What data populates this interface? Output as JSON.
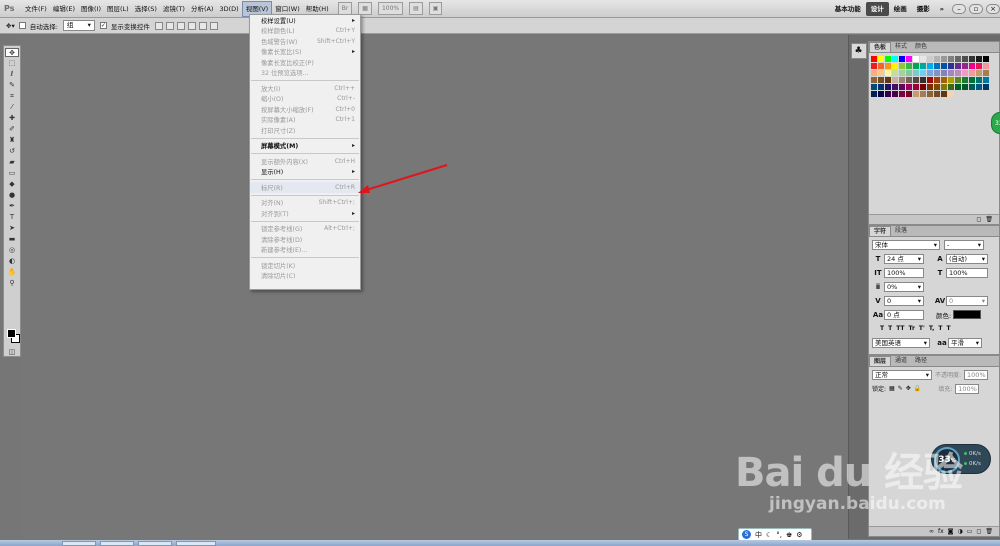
{
  "app": {
    "logo": "Ps"
  },
  "menubar": {
    "items": [
      "文件(F)",
      "编辑(E)",
      "图像(I)",
      "图层(L)",
      "选择(S)",
      "滤镜(T)",
      "分析(A)",
      "3D(D)",
      "视图(V)",
      "窗口(W)",
      "帮助(H)"
    ],
    "zoom": "100%",
    "workspaces": [
      "基本功能",
      "设计",
      "绘画",
      "摄影"
    ],
    "active_workspace": "设计",
    "more": "»"
  },
  "options": {
    "auto_select_label": "自动选择:",
    "auto_select_value": "组",
    "show_transform_label": "显示变换控件"
  },
  "view_menu": {
    "items": [
      {
        "label": "校样设置(U)",
        "shortcut": "",
        "submenu": true,
        "enabled": true
      },
      {
        "label": "校样颜色(L)",
        "shortcut": "Ctrl+Y",
        "submenu": false,
        "enabled": false
      },
      {
        "label": "色域警告(W)",
        "shortcut": "Shift+Ctrl+Y",
        "submenu": false,
        "enabled": false
      },
      {
        "label": "像素长宽比(S)",
        "shortcut": "",
        "submenu": true,
        "enabled": false
      },
      {
        "label": "像素长宽比校正(P)",
        "shortcut": "",
        "submenu": false,
        "enabled": false
      },
      {
        "label": "32 位预览选项...",
        "shortcut": "",
        "submenu": false,
        "enabled": false
      },
      {
        "sep": true
      },
      {
        "label": "放大(I)",
        "shortcut": "Ctrl++",
        "submenu": false,
        "enabled": false
      },
      {
        "label": "缩小(O)",
        "shortcut": "Ctrl+-",
        "submenu": false,
        "enabled": false
      },
      {
        "label": "按屏幕大小缩放(F)",
        "shortcut": "Ctrl+0",
        "submenu": false,
        "enabled": false
      },
      {
        "label": "实际像素(A)",
        "shortcut": "Ctrl+1",
        "submenu": false,
        "enabled": false
      },
      {
        "label": "打印尺寸(Z)",
        "shortcut": "",
        "submenu": false,
        "enabled": false
      },
      {
        "sep": true
      },
      {
        "label": "屏幕模式(M)",
        "shortcut": "",
        "submenu": true,
        "enabled": true,
        "bold": true
      },
      {
        "sep": true
      },
      {
        "label": "显示额外内容(X)",
        "shortcut": "Ctrl+H",
        "submenu": false,
        "enabled": false
      },
      {
        "label": "显示(H)",
        "shortcut": "",
        "submenu": true,
        "enabled": true
      },
      {
        "sep": true
      },
      {
        "label": "标尺(R)",
        "shortcut": "Ctrl+R",
        "submenu": false,
        "enabled": false,
        "highlight": true
      },
      {
        "sep": true
      },
      {
        "label": "对齐(N)",
        "shortcut": "Shift+Ctrl+;",
        "submenu": false,
        "enabled": false
      },
      {
        "label": "对齐到(T)",
        "shortcut": "",
        "submenu": true,
        "enabled": false
      },
      {
        "sep": true
      },
      {
        "label": "锁定参考线(G)",
        "shortcut": "Alt+Ctrl+;",
        "submenu": false,
        "enabled": false
      },
      {
        "label": "清除参考线(D)",
        "shortcut": "",
        "submenu": false,
        "enabled": false
      },
      {
        "label": "新建参考线(E)...",
        "shortcut": "",
        "submenu": false,
        "enabled": false
      },
      {
        "sep": true
      },
      {
        "label": "锁定切片(K)",
        "shortcut": "",
        "submenu": false,
        "enabled": false
      },
      {
        "label": "清除切片(C)",
        "shortcut": "",
        "submenu": false,
        "enabled": false
      }
    ]
  },
  "swatches_panel": {
    "tabs": [
      "色板",
      "样式",
      "颜色"
    ],
    "colors": [
      "#ff0000",
      "#ffff00",
      "#00ff00",
      "#00ffff",
      "#0000ff",
      "#ff00ff",
      "#ffffff",
      "#e6e6e6",
      "#cccccc",
      "#b3b3b3",
      "#999999",
      "#808080",
      "#666666",
      "#4d4d4d",
      "#333333",
      "#1a1a1a",
      "#000000",
      "#ed1c24",
      "#f26522",
      "#f7941d",
      "#fff200",
      "#8dc63f",
      "#39b54a",
      "#00a651",
      "#00a99d",
      "#00aeef",
      "#0072bc",
      "#0054a6",
      "#2e3192",
      "#662d91",
      "#92278f",
      "#ec008c",
      "#ed145b",
      "#f5989d",
      "#f9ad81",
      "#fdc68a",
      "#fff799",
      "#c4df9b",
      "#a3d39c",
      "#82ca9c",
      "#7accc8",
      "#6dcff6",
      "#7da7d9",
      "#8393ca",
      "#8781bd",
      "#a187be",
      "#bd8cbf",
      "#f49ac1",
      "#f6989d",
      "#c69c6d",
      "#a67c52",
      "#8c6239",
      "#754c24",
      "#603913",
      "#c7b299",
      "#998675",
      "#736357",
      "#534741",
      "#362f2d",
      "#9e0b0f",
      "#a0410d",
      "#a36209",
      "#aba000",
      "#598527",
      "#1a7b30",
      "#007236",
      "#00746b",
      "#0076a3",
      "#004a80",
      "#003471",
      "#1b1464",
      "#440e62",
      "#630460",
      "#9e005d",
      "#9e0039",
      "#790000",
      "#7b2e00",
      "#7d4900",
      "#827b00",
      "#406618",
      "#005e20",
      "#005826",
      "#005952",
      "#005b7f",
      "#003663",
      "#002157",
      "#0d004c",
      "#32004b",
      "#4b0049",
      "#7b0046",
      "#7a0026",
      "#c69c6d",
      "#a67c52",
      "#8c6239",
      "#754c24",
      "#603913",
      "#f2d6b3"
    ]
  },
  "character_panel": {
    "tabs": [
      "字符",
      "段落"
    ],
    "font": "宋体",
    "style": "-",
    "size": "24 点",
    "leading": "(自动)",
    "vscale": "100%",
    "hscale": "100%",
    "tracking_pct": "0%",
    "kerning": "0",
    "tracking": "0",
    "baseline": "0 点",
    "color_label": "颜色:",
    "format_buttons": [
      "T",
      "T",
      "TT",
      "Tr",
      "T'",
      "T,",
      "T",
      "T"
    ],
    "language": "美国英语",
    "antialias": "平滑"
  },
  "layers_panel": {
    "tabs": [
      "图层",
      "通道",
      "路径"
    ],
    "blend_mode": "正常",
    "opacity_label": "不透明度:",
    "opacity": "100%",
    "lock_label": "锁定:",
    "fill_label": "填充:",
    "fill": "100%"
  },
  "overlays": {
    "watermark_main": "Bai du 经验",
    "watermark_sub": "jingyan.baidu.com",
    "net_percent": "33",
    "net_unit": "%",
    "net_up": "0K/s",
    "net_down": "0K/s",
    "green_float": "33",
    "ime_text": "中"
  },
  "colors": {
    "accent": "#b9c5d8",
    "arrow": "#e0141b",
    "canvas": "#777777"
  }
}
